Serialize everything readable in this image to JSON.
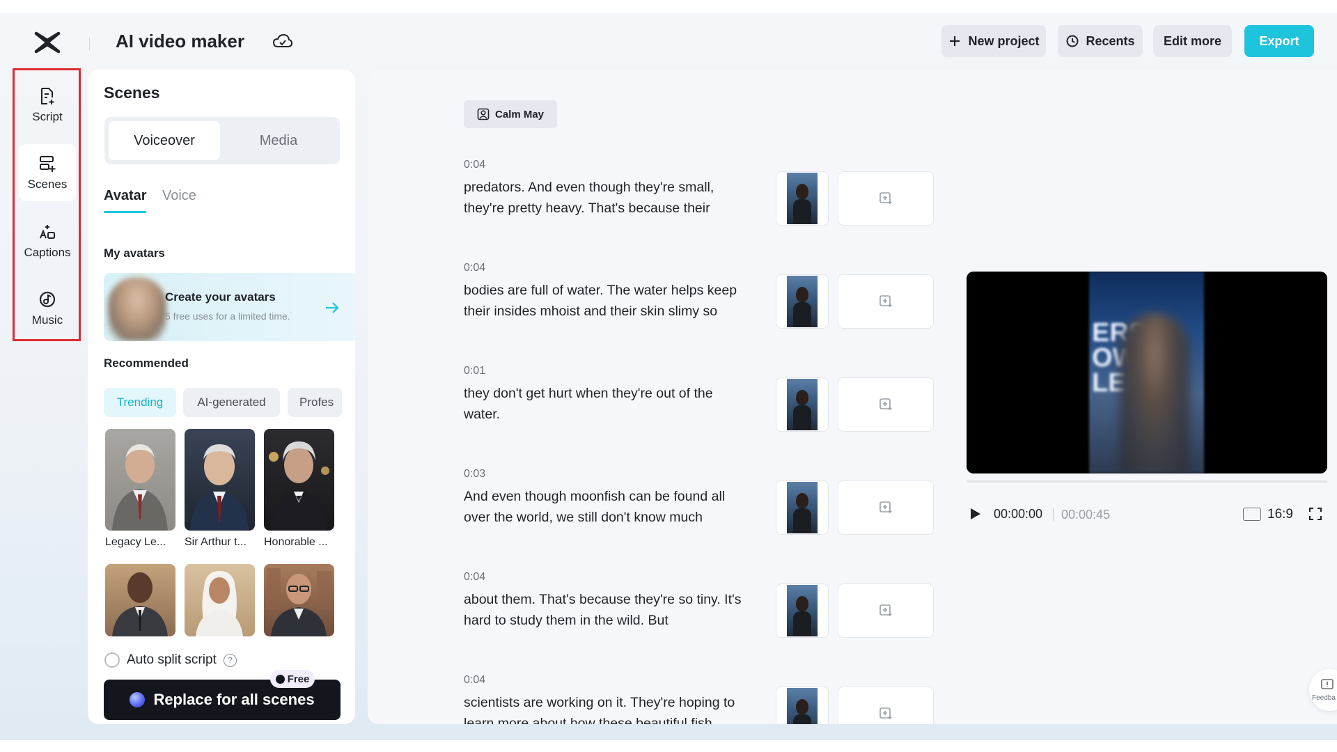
{
  "app": {
    "title": "AI video maker",
    "accent_color": "#1ec4dc"
  },
  "header": {
    "buttons": {
      "new_project": "New project",
      "recents": "Recents",
      "edit_more": "Edit more",
      "export": "Export"
    },
    "icons": [
      "logo-icon",
      "cloud-icon",
      "plus-icon",
      "clock-icon"
    ]
  },
  "rail": {
    "items": [
      {
        "label": "Script",
        "icon": "script-icon"
      },
      {
        "label": "Scenes",
        "icon": "scenes-icon"
      },
      {
        "label": "Captions",
        "icon": "captions-icon"
      },
      {
        "label": "Music",
        "icon": "music-icon"
      }
    ],
    "active": "Scenes"
  },
  "scenes_panel": {
    "title": "Scenes",
    "mode_tabs": [
      "Voiceover",
      "Media"
    ],
    "sub_tabs": [
      "Avatar",
      "Voice"
    ],
    "my_avatars_label": "My avatars",
    "create_card": {
      "title": "Create your avatars",
      "subtitle": "5 free uses for a limited time."
    },
    "recommended_label": "Recommended",
    "chips": [
      "Trending",
      "AI-generated",
      "Profes"
    ],
    "avatars": [
      {
        "name": "Legacy Le..."
      },
      {
        "name": "Sir Arthur t..."
      },
      {
        "name": "Honorable ..."
      },
      {
        "name": ""
      },
      {
        "name": ""
      },
      {
        "name": ""
      }
    ],
    "auto_split_label": "Auto split script",
    "replace_button": "Replace for all scenes",
    "free_badge": "Free"
  },
  "script": {
    "speaker": "Calm May",
    "scenes": [
      {
        "time": "0:04",
        "line1": "predators. And even though they're small,",
        "line2": "they're pretty heavy. That's because their"
      },
      {
        "time": "0:04",
        "line1": "bodies are full of water. The water helps keep",
        "line2": "their insides mhoist and their skin slimy so"
      },
      {
        "time": "0:01",
        "line1": "they don't get hurt when they're out of the",
        "line2": "water."
      },
      {
        "time": "0:03",
        "line1": "And even though moonfish can be found all",
        "line2": "over the world, we still don't know much"
      },
      {
        "time": "0:04",
        "line1": "about them. That's because they're so tiny. It's",
        "line2": "hard to study them in the wild. But"
      },
      {
        "time": "0:04",
        "line1": "scientists are working on it. They're hoping to",
        "line2": "learn more about how these beautiful fish"
      }
    ]
  },
  "preview": {
    "current_time": "00:00:00",
    "total_time": "00:00:45",
    "progress": 0,
    "aspect_ratio": "16:9",
    "overlay_text": "ERS\nOW\nLEN"
  },
  "feedback": {
    "label": "Feedba"
  }
}
